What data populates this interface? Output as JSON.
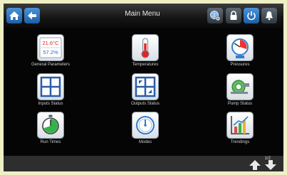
{
  "header": {
    "title": "Main Menu"
  },
  "menu": [
    {
      "label": "General Parameters",
      "temp": "21.6°C",
      "humidity": "57.2%"
    },
    {
      "label": "Temperatures"
    },
    {
      "label": "Pressures"
    },
    {
      "label": "Inputs Status"
    },
    {
      "label": "Outputs Status"
    },
    {
      "label": "Pump Status"
    },
    {
      "label": "Run Times"
    },
    {
      "label": "Modes"
    },
    {
      "label": "Trendings"
    }
  ],
  "footer": {
    "page": "1/2"
  },
  "colors": {
    "accent": "#2f7fd0",
    "background": "#050505"
  },
  "icons": [
    "home-icon",
    "back-arrow-icon",
    "network-settings-icon",
    "lock-icon",
    "power-icon",
    "alarm-bell-icon"
  ]
}
